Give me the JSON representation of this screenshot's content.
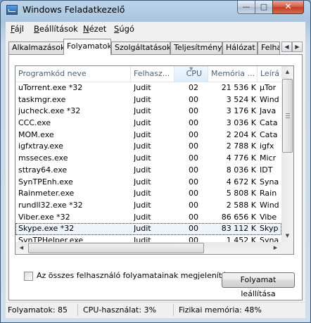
{
  "window": {
    "title": "Windows Feladatkezelő",
    "minimize": "—",
    "maximize": "□",
    "close": "✕"
  },
  "menu": [
    {
      "label": "Fájl",
      "accel": "F",
      "rest": "ájl"
    },
    {
      "label": "Beállítások",
      "accel": "B",
      "rest": "eállítások"
    },
    {
      "label": "Nézet",
      "accel": "N",
      "rest": "ézet"
    },
    {
      "label": "Súgó",
      "accel": "S",
      "rest": "úgó"
    }
  ],
  "tabs": [
    {
      "label": "Alkalmazások"
    },
    {
      "label": "Folyamatok"
    },
    {
      "label": "Szolgáltatások"
    },
    {
      "label": "Teljesítmény"
    },
    {
      "label": "Hálózat"
    },
    {
      "label": "Felhas"
    }
  ],
  "active_tab": "Folyamatok",
  "table": {
    "columns": [
      "Programkód neve",
      "Felhasz...",
      "CPU",
      "Memória ...",
      "Leírá"
    ],
    "sorted_column": "CPU",
    "rows": [
      [
        "uTorrent.exe *32",
        "Judit",
        "02",
        "21 536 K",
        "µTor"
      ],
      [
        "taskmgr.exe",
        "Judit",
        "00",
        "3 524 K",
        "Wind"
      ],
      [
        "jucheck.exe *32",
        "Judit",
        "00",
        "3 176 K",
        "Java"
      ],
      [
        "CCC.exe",
        "Judit",
        "00",
        "3 036 K",
        "Cata"
      ],
      [
        "MOM.exe",
        "Judit",
        "00",
        "2 204 K",
        "Cata"
      ],
      [
        "igfxtray.exe",
        "Judit",
        "00",
        "2 788 K",
        "igfx"
      ],
      [
        "msseces.exe",
        "Judit",
        "00",
        "4 776 K",
        "Micr"
      ],
      [
        "sttray64.exe",
        "Judit",
        "00",
        "8 036 K",
        "IDT"
      ],
      [
        "SynTPEnh.exe",
        "Judit",
        "00",
        "4 672 K",
        "Syna"
      ],
      [
        "Rainmeter.exe",
        "Judit",
        "00",
        "5 808 K",
        "Rain"
      ],
      [
        "rundll32.exe *32",
        "Judit",
        "00",
        "2 588 K",
        "Wind"
      ],
      [
        "Viber.exe *32",
        "Judit",
        "00",
        "86 656 K",
        "Vibe"
      ],
      [
        "Skype.exe *32",
        "Judit",
        "00",
        "83 112 K",
        "Skyp"
      ],
      [
        "SynTPHelper.exe",
        "Judit",
        "00",
        "1 452 K",
        "Syna"
      ]
    ],
    "selected_row": 12
  },
  "show_all_checkbox": {
    "label": "Az összes felhasználó folyamatainak megjelenítése",
    "checked": false
  },
  "end_process_button": "Folyamat leállítása",
  "status": {
    "processes": "Folyamatok: 85",
    "cpu": "CPU-használat: 3%",
    "memory": "Fizikai memória: 48%"
  }
}
